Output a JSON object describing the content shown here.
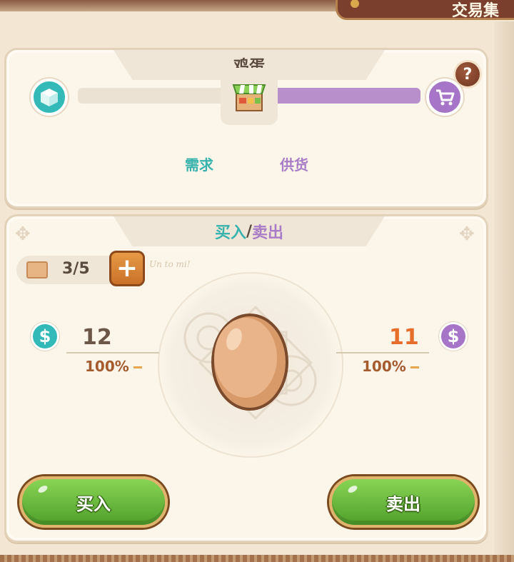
{
  "top": {
    "tab_title": "交易集"
  },
  "item_panel": {
    "item_name": "鸡蛋",
    "help_label": "?",
    "demand_label": "需求",
    "supply_label": "供货",
    "supply_fill": 0.5
  },
  "trade_panel": {
    "title_buy": "买入",
    "title_slash": "/",
    "title_sell": "卖出",
    "capacity": "3/5",
    "plus_label": "+",
    "sketch_note": "Un to mi!",
    "buy": {
      "currency": "$",
      "price": "12",
      "percent": "100%"
    },
    "sell": {
      "currency": "$",
      "price": "11",
      "percent": "100%"
    },
    "buy_button": "买入",
    "sell_button": "卖出"
  },
  "colors": {
    "teal": "#33b9b8",
    "purple": "#a675c7",
    "green_button": "#6cc040",
    "sell_price": "#e66d2a"
  }
}
